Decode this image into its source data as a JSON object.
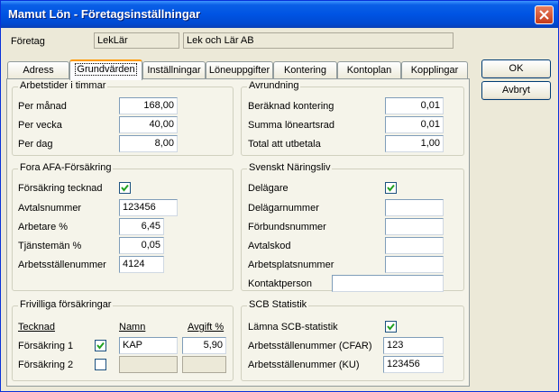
{
  "window": {
    "title": "Mamut Lön - Företagsinställningar"
  },
  "company": {
    "label": "Företag",
    "code": "LekLär",
    "name": "Lek och Lär AB"
  },
  "tabs": [
    "Adress",
    "Grundvärden",
    "Inställningar",
    "Löneuppgifter",
    "Kontering",
    "Kontoplan",
    "Kopplingar"
  ],
  "buttons": {
    "ok": "OK",
    "cancel": "Avbryt"
  },
  "arbetstider": {
    "title": "Arbetstider i timmar",
    "rows": [
      {
        "label": "Per månad",
        "value": "168,00"
      },
      {
        "label": "Per vecka",
        "value": "40,00"
      },
      {
        "label": "Per dag",
        "value": "8,00"
      }
    ]
  },
  "avrundning": {
    "title": "Avrundning",
    "rows": [
      {
        "label": "Beräknad kontering",
        "value": "0,01"
      },
      {
        "label": "Summa löneartsrad",
        "value": "0,01"
      },
      {
        "label": "Total att utbetala",
        "value": "1,00"
      }
    ]
  },
  "fora": {
    "title": "Fora AFA-Försäkring",
    "forsakring_label": "Försäkring tecknad",
    "forsakring_checked": true,
    "avtalsnummer_label": "Avtalsnummer",
    "avtalsnummer": "123456",
    "arbetare_label": "Arbetare %",
    "arbetare": "6,45",
    "tjansteman_label": "Tjänstemän %",
    "tjansteman": "0,05",
    "arbetsstalle_label": "Arbetsställenummer",
    "arbetsstalle": "4124"
  },
  "naringsliv": {
    "title": "Svenskt Näringsliv",
    "delagare_label": "Delägare",
    "delagare_checked": true,
    "delagarnummer_label": "Delägarnummer",
    "delagarnummer": "",
    "forbundsnummer_label": "Förbundsnummer",
    "forbundsnummer": "",
    "avtalskod_label": "Avtalskod",
    "avtalskod": "",
    "arbetsplatsnummer_label": "Arbetsplatsnummer",
    "arbetsplatsnummer": "",
    "kontaktperson_label": "Kontaktperson",
    "kontaktperson": ""
  },
  "frivilliga": {
    "title": "Frivilliga försäkringar",
    "col_tecknad": "Tecknad",
    "col_namn": "Namn",
    "col_avgift": "Avgift %",
    "rows": [
      {
        "label": "Försäkring 1",
        "checked": true,
        "namn": "KAP",
        "avgift": "5,90"
      },
      {
        "label": "Försäkring 2",
        "checked": false,
        "namn": "",
        "avgift": ""
      }
    ]
  },
  "scb": {
    "title": "SCB Statistik",
    "lamna_label": "Lämna SCB-statistik",
    "lamna_checked": true,
    "cfar_label": "Arbetsställenummer (CFAR)",
    "cfar": "123",
    "ku_label": "Arbetsställenummer (KU)",
    "ku": "123456"
  }
}
